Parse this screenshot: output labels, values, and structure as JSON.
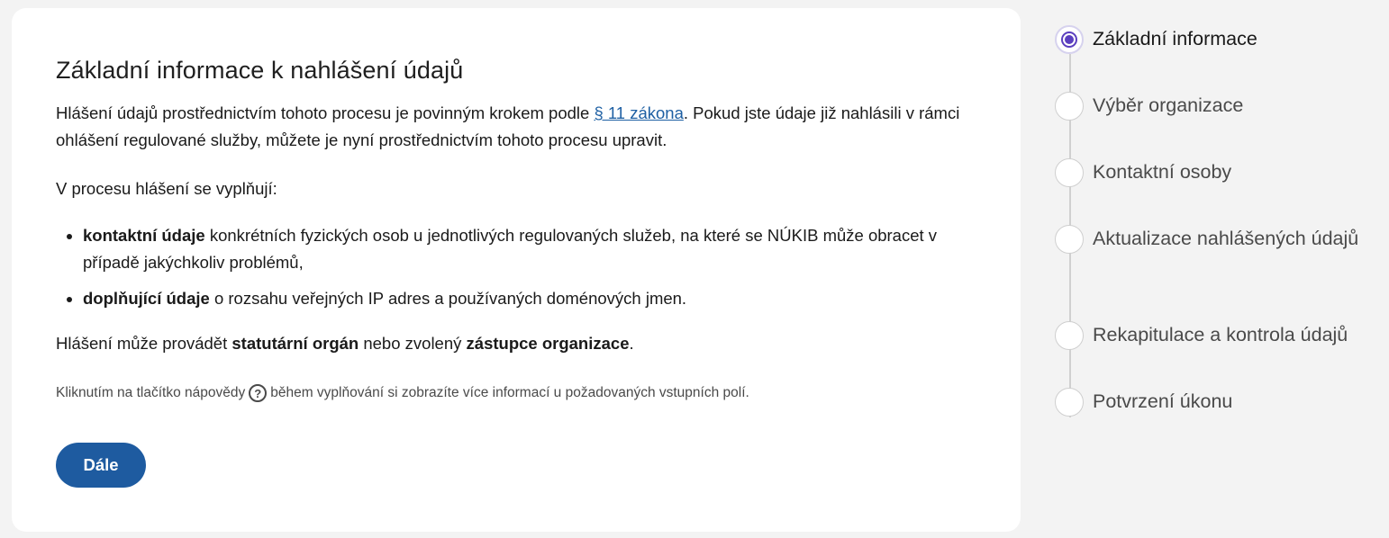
{
  "main": {
    "title": "Základní informace k nahlášení údajů",
    "p1_before": "Hlášení údajů prostřednictvím tohoto procesu je povinným krokem podle ",
    "p1_link": "§ 11 zákona",
    "p1_after": ". Pokud jste údaje již nahlásili v rámci ohlášení regulované služby, můžete je nyní prostřednictvím tohoto procesu upravit.",
    "p2": "V procesu hlášení se vyplňují:",
    "list": [
      {
        "bold": "kontaktní údaje",
        "text": " konkrétních fyzických osob u jednotlivých regulovaných služeb, na které se NÚKIB může obracet v případě jakýchkoliv problémů,"
      },
      {
        "bold": "doplňující údaje",
        "text": " o rozsahu veřejných IP adres a používaných doménových jmen."
      }
    ],
    "p3_1": "Hlášení může provádět ",
    "p3_b1": "statutární orgán",
    "p3_2": " nebo zvolený ",
    "p3_b2": "zástupce organizace",
    "p3_3": ".",
    "hint_before": "Kliknutím na tlačítko nápovědy",
    "hint_icon": "?",
    "hint_after": "během vyplňování si zobrazíte více informací u požadovaných vstupních polí.",
    "next_button": "Dále"
  },
  "stepper": {
    "steps": [
      {
        "label": "Základní informace",
        "active": true
      },
      {
        "label": "Výběr organizace",
        "active": false
      },
      {
        "label": "Kontaktní osoby",
        "active": false
      },
      {
        "label": "Aktualizace nahlášených údajů",
        "active": false
      },
      {
        "label": "Rekapitulace a kontrola údajů",
        "active": false
      },
      {
        "label": "Potvrzení úkonu",
        "active": false
      }
    ],
    "accent_color": "#5b3fbf"
  },
  "colors": {
    "button": "#1e5ba0",
    "link": "#1d5fa3",
    "background": "#f3f3f3"
  }
}
